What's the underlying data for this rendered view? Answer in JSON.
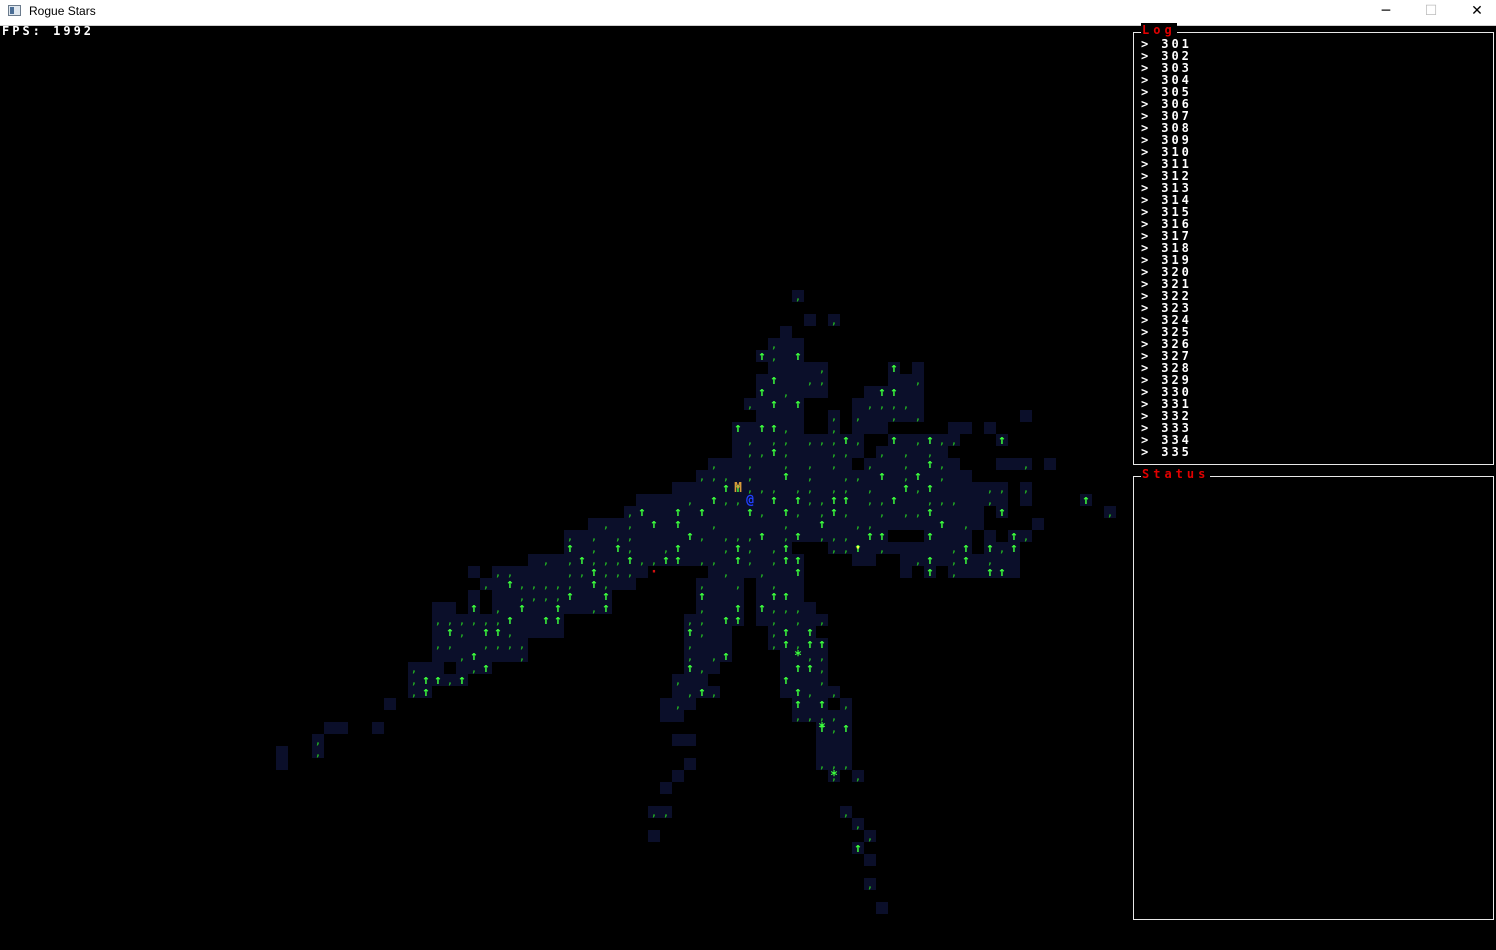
{
  "window": {
    "title": "Rogue Stars",
    "minimize": "─",
    "maximize": "☐",
    "close": "✕"
  },
  "hud": {
    "fps": "FPS: 1992"
  },
  "log": {
    "title": "Log",
    "prompt": ">",
    "entries": [
      "301",
      "302",
      "303",
      "304",
      "305",
      "306",
      "307",
      "308",
      "309",
      "310",
      "311",
      "312",
      "313",
      "314",
      "315",
      "316",
      "317",
      "318",
      "319",
      "320",
      "321",
      "322",
      "323",
      "324",
      "325",
      "326",
      "327",
      "328",
      "329",
      "330",
      "331",
      "332",
      "333",
      "334",
      "335"
    ]
  },
  "status": {
    "title": "Status"
  },
  "map": {
    "colors": {
      "floor": "#0b0f2a",
      "tree": "#3cff3c",
      "grass": "#22b022",
      "player": "#2040ff",
      "monster": "#d79a3a",
      "item": "#ffff40",
      "blood": "#d01010",
      "star": "#3cff3c"
    },
    "glyphs": {
      "tree": "↑",
      "grass": ",",
      "player": "@",
      "monster": "M",
      "item": "·",
      "star": "*"
    }
  }
}
